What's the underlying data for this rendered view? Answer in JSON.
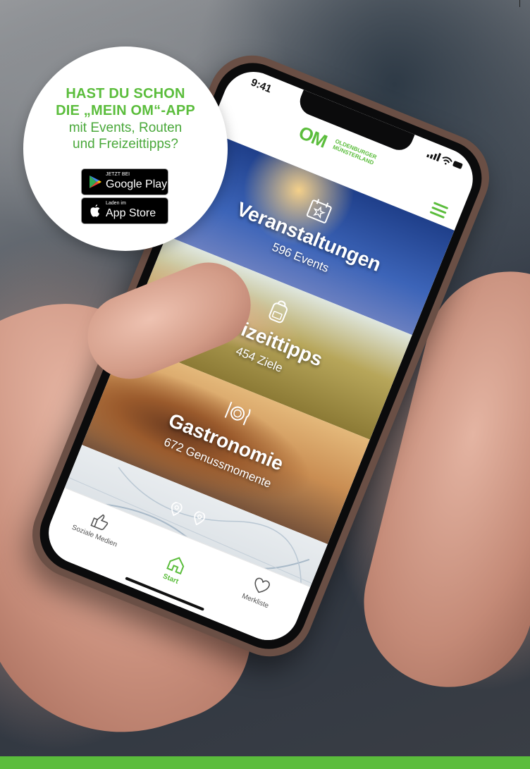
{
  "colors": {
    "brand_green": "#5bbd3c"
  },
  "badge": {
    "headline": "HAST DU SCHON\nDIE „MEIN OM“-APP",
    "subline": "mit Events, Routen\nund Freizeittipps?"
  },
  "stores": {
    "google_small": "JETZT BEI",
    "google_big": "Google Play",
    "apple_small": "Laden im",
    "apple_big": "App Store"
  },
  "phone": {
    "time": "9:41",
    "logo_mark": "OM",
    "logo_text": "OLDENBURGER\nMÜNSTERLAND",
    "tiles": [
      {
        "title": "Veranstaltungen",
        "count": "596 Events",
        "icon": "calendar-star-icon"
      },
      {
        "title": "Freizeittipps",
        "count": "454 Ziele",
        "icon": "backpack-icon"
      },
      {
        "title": "Gastronomie",
        "count": "672 Genussmomente",
        "icon": "plate-cutlery-icon"
      }
    ],
    "tabs": [
      {
        "label": "Soziale Medien",
        "icon": "thumbs-up-icon"
      },
      {
        "label": "Start",
        "icon": "home-icon"
      },
      {
        "label": "Merkliste",
        "icon": "heart-icon"
      }
    ]
  }
}
